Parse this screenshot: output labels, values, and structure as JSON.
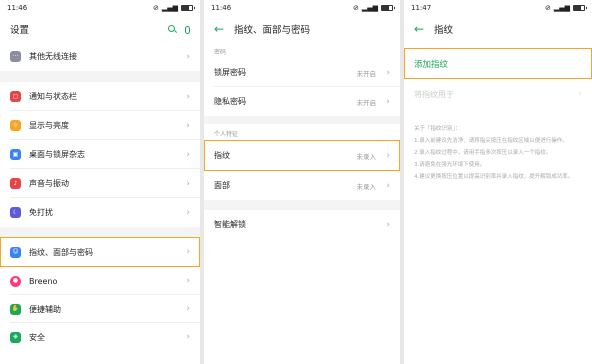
{
  "status": {
    "time1": "11:46",
    "time2": "11:46",
    "time3": "11:47"
  },
  "panel1": {
    "title": "设置",
    "items": [
      {
        "label": "其他无线连接",
        "icon": "more-dots-icon",
        "color": "#8a8fa0"
      },
      {
        "label": "通知与状态栏",
        "icon": "notification-icon",
        "color": "#e64545"
      },
      {
        "label": "显示与亮度",
        "icon": "brightness-icon",
        "color": "#f5a623"
      },
      {
        "label": "桌面与锁屏杂志",
        "icon": "wallpaper-icon",
        "color": "#3b82f6"
      },
      {
        "label": "声音与振动",
        "icon": "sound-icon",
        "color": "#e64545"
      },
      {
        "label": "免打扰",
        "icon": "moon-icon",
        "color": "#5b5bd6"
      },
      {
        "label": "指纹、面部与密码",
        "icon": "fingerprint-face-icon",
        "color": "#3b82f6"
      },
      {
        "label": "Breeno",
        "icon": "breeno-icon",
        "color": "#ff3b7a"
      },
      {
        "label": "便捷辅助",
        "icon": "assist-icon",
        "color": "#1aa85c"
      },
      {
        "label": "安全",
        "icon": "shield-icon",
        "color": "#1aa85c"
      }
    ]
  },
  "panel2": {
    "title": "指纹、面部与密码",
    "section_password": "密码",
    "lock_screen_label": "锁屏密码",
    "lock_screen_value": "未开启",
    "privacy_label": "隐私密码",
    "privacy_value": "未开启",
    "section_bio": "个人特征",
    "fingerprint_label": "指纹",
    "fingerprint_value": "未录入",
    "face_label": "面部",
    "face_value": "未录入",
    "smart_unlock_label": "智能解锁"
  },
  "panel3": {
    "title": "指纹",
    "add_label": "添加指纹",
    "usage_label": "将指纹用于",
    "notes_title": "关于「指纹识别」：",
    "notes": [
      "1.录入前建议先洁净、请将指尖按压在指纹区域以便进行操作。",
      "2.录入指纹过程中，请用手指多次按压以录入一个指纹。",
      "3.请避免在强光环境下使用。",
      "4.建议更换按压位置以提高识别率并录入指纹，提升解锁成功率。"
    ]
  },
  "colors": {
    "accent": "#1aa85c",
    "highlight": "#f5a623"
  }
}
